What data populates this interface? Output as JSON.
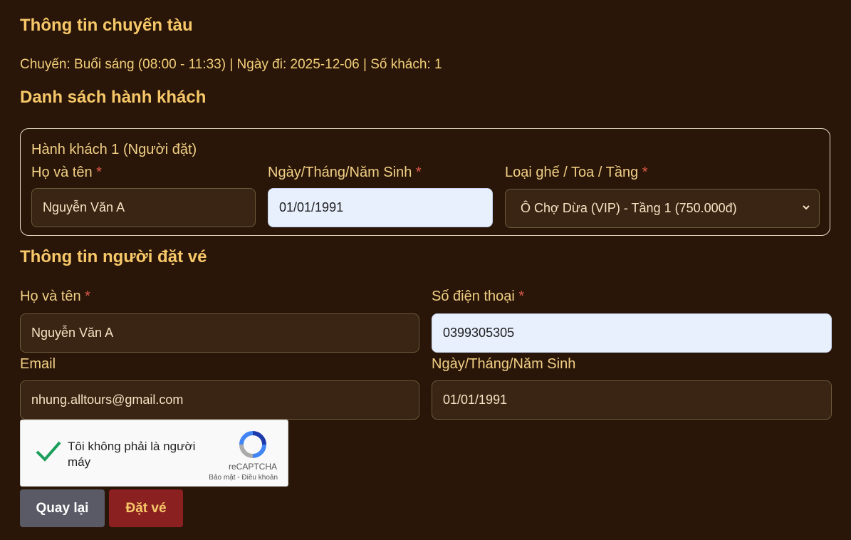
{
  "trip": {
    "heading": "Thông tin chuyến tàu",
    "summary": "Chuyến: Buổi sáng (08:00 - 11:33) | Ngày đi: 2025-12-06 | Số khách: 1"
  },
  "passengers": {
    "heading": "Danh sách hành khách",
    "items": [
      {
        "title": "Hành khách 1 (Người đặt)",
        "name_label": "Họ và tên",
        "name_value": "Nguyễn Văn A",
        "dob_label": "Ngày/Tháng/Năm Sinh",
        "dob_value": "01/01/1991",
        "seat_label": "Loại ghế / Toa / Tầng",
        "seat_value": "Ô Chợ Dừa (VIP) - Tầng 1 (750.000đ)"
      }
    ]
  },
  "booker": {
    "heading": "Thông tin người đặt vé",
    "name_label": "Họ và tên",
    "name_value": "Nguyễn Văn A",
    "phone_label": "Số điện thoại",
    "phone_value": "0399305305",
    "email_label": "Email",
    "email_value": "nhung.alltours@gmail.com",
    "dob_label": "Ngày/Tháng/Năm Sinh",
    "dob_value": "01/01/1991"
  },
  "required_marker": "*",
  "captcha": {
    "label": "Tôi không phải là người máy",
    "brand": "reCAPTCHA",
    "footer": "Bảo mật - Điều khoản",
    "checked": true
  },
  "buttons": {
    "back": "Quay lại",
    "book": "Đặt vé"
  },
  "colors": {
    "background": "#2a1608",
    "heading": "#f7c869",
    "book_button": "#8b2020",
    "back_button": "#5a5a66"
  }
}
